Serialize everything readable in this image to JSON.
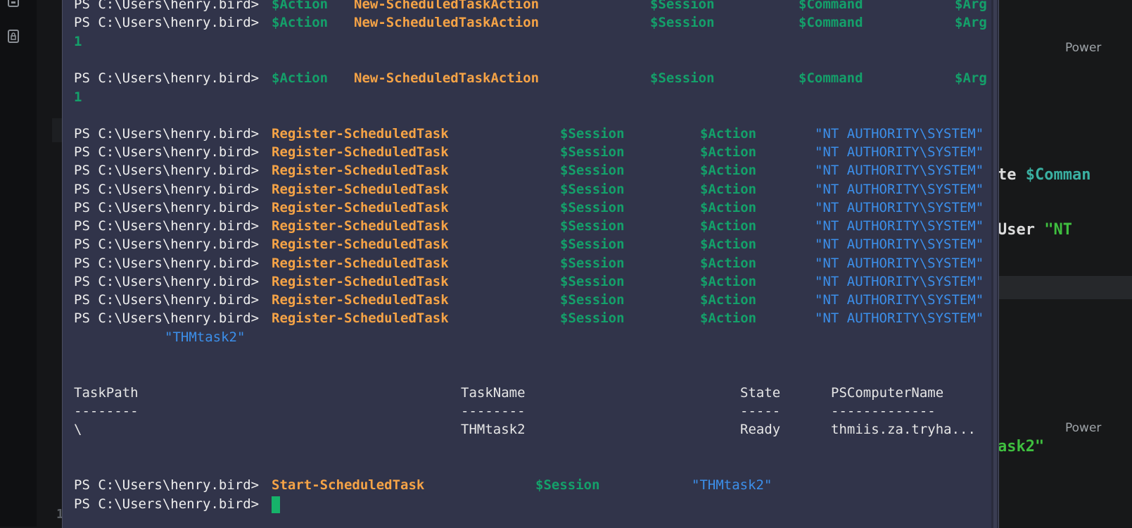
{
  "terminal": {
    "prompt": "PS C:\\Users\\henry.bird>",
    "new_action": {
      "var": "$Action",
      "cmd": "New-ScheduledTaskAction",
      "session": "$Session",
      "command": "$Command",
      "arg": "$Arg",
      "result": "1"
    },
    "register": {
      "cmd": "Register-ScheduledTask",
      "session": "$Session",
      "action": "$Action",
      "user": "\"NT AUTHORITY\\SYSTEM\"",
      "continuation": "\"THMtask2\""
    },
    "table": {
      "headers": [
        "TaskPath",
        "TaskName",
        "State",
        "PSComputerName"
      ],
      "underlines": [
        "--------",
        "--------",
        "-----",
        "-------------"
      ],
      "row": [
        "\\",
        "THMtask2",
        "Ready",
        "thmiis.za.tryha..."
      ]
    },
    "start": {
      "cmd": "Start-ScheduledTask",
      "session": "$Session",
      "name": "\"THMtask2\""
    }
  },
  "background_editor": {
    "fragment_1_plain": "te ",
    "fragment_1_var": "$Comman",
    "fragment_2_plain": "User ",
    "fragment_2_str": "\"NT",
    "fragment_3_str": "ask2\"",
    "hint_top": "Power",
    "hint_bottom": "Power",
    "gutter_number": "1"
  },
  "colors": {
    "terminal_bg": "#31344a",
    "cmdlet": "#f5a346",
    "variable": "#14a06a",
    "string": "#3c8fea",
    "cursor": "#16b36a"
  }
}
